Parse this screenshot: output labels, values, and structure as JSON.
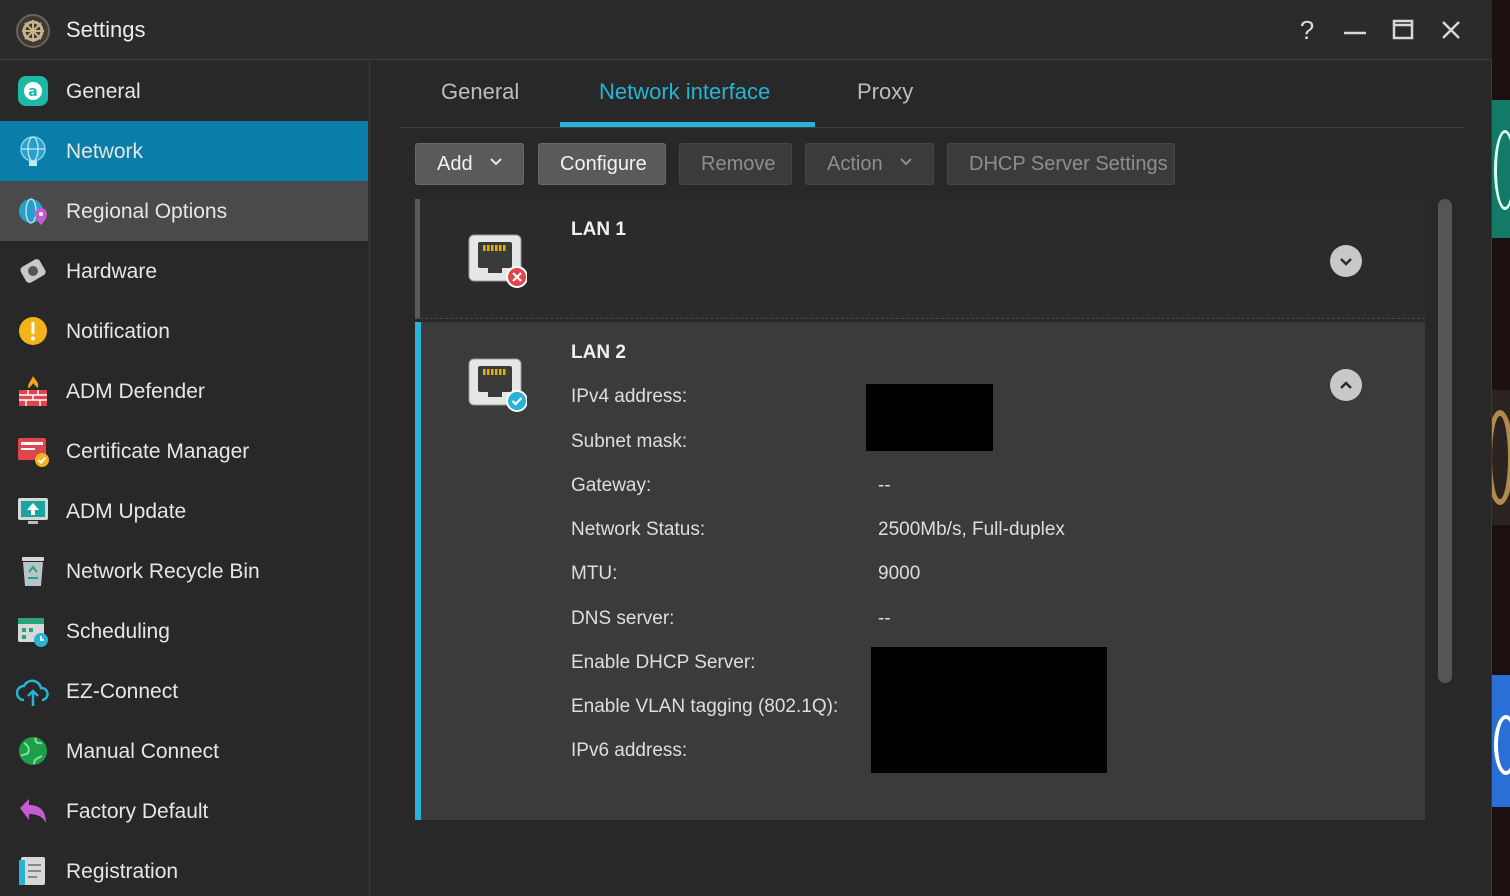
{
  "window": {
    "title": "Settings",
    "controls": {
      "help": "?",
      "minimize": "—",
      "maximize": "☐",
      "close": "✕"
    }
  },
  "sidebar": {
    "items": [
      {
        "label": "General",
        "icon": "general-icon"
      },
      {
        "label": "Network",
        "icon": "network-globe-icon",
        "state": "active"
      },
      {
        "label": "Regional Options",
        "icon": "regional-globe-pin-icon",
        "state": "hover"
      },
      {
        "label": "Hardware",
        "icon": "hardware-icon"
      },
      {
        "label": "Notification",
        "icon": "alert-icon"
      },
      {
        "label": "ADM Defender",
        "icon": "firewall-icon"
      },
      {
        "label": "Certificate Manager",
        "icon": "certificate-icon"
      },
      {
        "label": "ADM Update",
        "icon": "update-monitor-icon"
      },
      {
        "label": "Network Recycle Bin",
        "icon": "recycle-bin-icon"
      },
      {
        "label": "Scheduling",
        "icon": "calendar-clock-icon"
      },
      {
        "label": "EZ-Connect",
        "icon": "cloud-upload-icon"
      },
      {
        "label": "Manual Connect",
        "icon": "globe-icon"
      },
      {
        "label": "Factory Default",
        "icon": "undo-arrow-icon"
      },
      {
        "label": "Registration",
        "icon": "registration-icon"
      }
    ]
  },
  "tabs": [
    {
      "label": "General"
    },
    {
      "label": "Network interface",
      "state": "active"
    },
    {
      "label": "Proxy"
    }
  ],
  "toolbar": {
    "add": "Add",
    "configure": "Configure",
    "remove": "Remove",
    "action": "Action",
    "dhcp": "DHCP Server Settings"
  },
  "interfaces": [
    {
      "name": "LAN 1",
      "status": "disconnected",
      "expanded": false
    },
    {
      "name": "LAN 2",
      "status": "connected",
      "expanded": true,
      "labels": {
        "ipv4": "IPv4 address:",
        "subnet": "Subnet mask:",
        "gateway": "Gateway:",
        "network_status": "Network Status:",
        "mtu": "MTU:",
        "dns": "DNS server:",
        "dhcp": "Enable DHCP Server:",
        "vlan": "Enable VLAN tagging (802.1Q):",
        "ipv6": "IPv6 address:"
      },
      "values": {
        "gateway": "--",
        "network_status": "2500Mb/s, Full-duplex",
        "mtu": "9000",
        "dns": "--"
      }
    }
  ],
  "colors": {
    "accent": "#27b3d6",
    "active_nav": "#0a7ea8",
    "error": "#e0454e"
  }
}
